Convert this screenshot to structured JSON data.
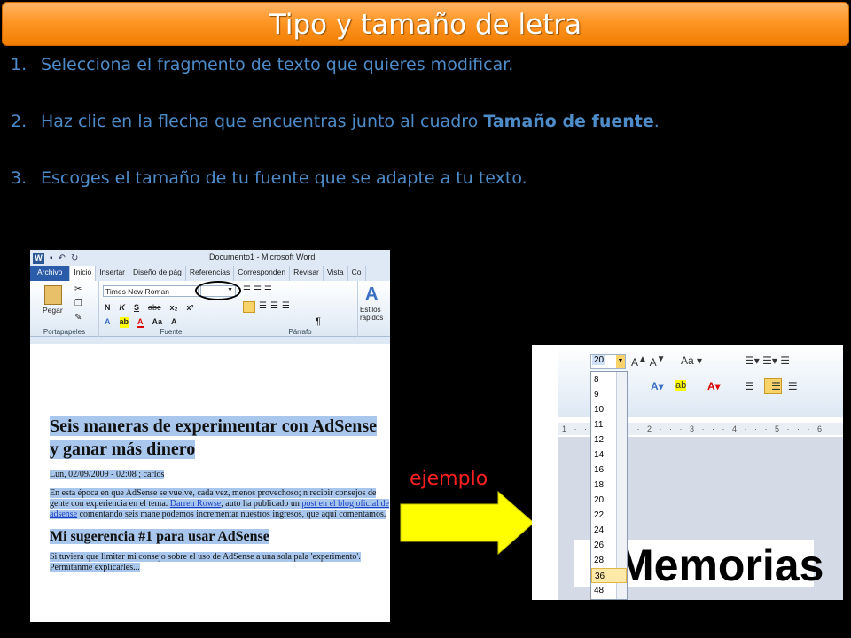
{
  "title": "Tipo y tamaño de letra",
  "steps": [
    {
      "num": "1.",
      "text": "Selecciona el fragmento de texto que quieres modificar.",
      "bold": ""
    },
    {
      "num": "2.",
      "text": "Haz clic en la flecha que encuentras junto al cuadro ",
      "bold": "Tamaño de fuente",
      "after": "."
    },
    {
      "num": "3.",
      "text": "Escoges el tamaño de tu fuente que se adapte a tu texto.",
      "bold": ""
    }
  ],
  "word": {
    "window_title": "Documento1  -  Microsoft Word",
    "tabs": [
      "Archivo",
      "Inicio",
      "Insertar",
      "Diseño de pág",
      "Referencias",
      "Corresponden",
      "Revisar",
      "Vista",
      "Co"
    ],
    "font_name": "Times New Roman",
    "groups": {
      "clipboard": "Portapapeles",
      "paste": "Pegar",
      "font": "Fuente",
      "paragraph": "Párrafo",
      "styles": "Estilos rápidos"
    },
    "doc": {
      "heading1": "Seis maneras de experimentar con AdSense y ganar más dinero",
      "meta": "Lun, 02/09/2009 - 02:08 ; carlos",
      "para1_a": "En esta época en que AdSense se vuelve, cada vez, menos provechoso; n recibir consejos de gente con experiencia  en el tema. ",
      "para1_link1": "Darren Rowse",
      "para1_b": ", auto ha publicado un ",
      "para1_link2": "post en el blog oficial de adsense",
      "para1_c": " comentando seis mane podemos incrementar nuestros ingresos, que aquí comentamos.",
      "heading2": "Mi sugerencia #1 para usar AdSense",
      "para2": "Si tuviera que limitar mi consejo sobre el uso de AdSense a una sola pala 'experimento'. Permítanme explicarles..."
    }
  },
  "example": {
    "label": "ejemplo",
    "current_size": "20",
    "sizes": [
      "8",
      "9",
      "10",
      "11",
      "12",
      "14",
      "16",
      "18",
      "20",
      "22",
      "24",
      "26",
      "28",
      "36",
      "48"
    ],
    "selected_size": "36",
    "ruler": "1 · · · 1 · · · 2 · · · 3 · · · 4 · · · 5 · · · 6",
    "preview_text": "Memorias"
  },
  "colors": {
    "title_bg": "#ff9626",
    "step_text": "#4d8cc8",
    "arrow": "#ffff00",
    "example_label": "#ff2020"
  }
}
